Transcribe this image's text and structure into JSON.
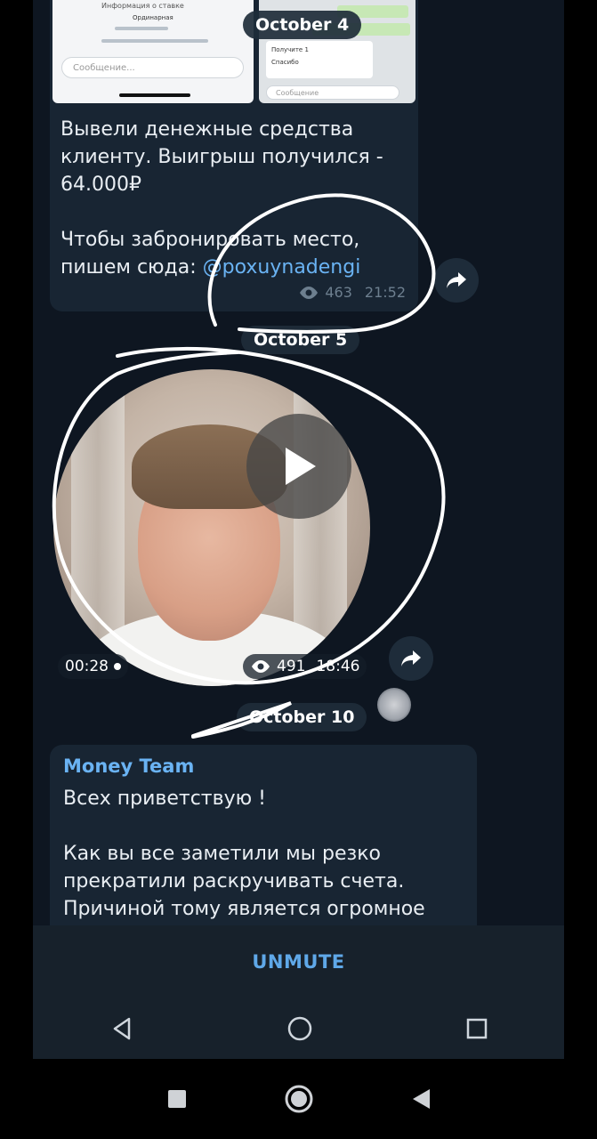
{
  "thumbnails": {
    "left_header": "Информация о ставке",
    "left_card": "Ординарная",
    "left_input_placeholder": "Сообщение...",
    "right_text_1": "Получите 1",
    "right_text_2": "Спасибо",
    "right_input_placeholder": "Сообщение"
  },
  "post1": {
    "line1": "Вывели денежные средства клиенту. Выигрыш получился - 64.000₽",
    "line2_prefix": "Чтобы забронировать место, пишем сюда: ",
    "link": "@poxuynadengi",
    "views": "463",
    "time": "21:52"
  },
  "dates": {
    "d1": "October 4",
    "d2": "October 5",
    "d3": "October 10"
  },
  "video": {
    "duration": "00:28",
    "views": "491",
    "time": "18:46"
  },
  "post2": {
    "sender": "Money Team",
    "line1": "Всех приветствую !",
    "line2": "Как вы все заметили мы резко прекратили раскручивать счета. Причиной тому является огромное"
  },
  "bottom": {
    "unmute": "UNMUTE"
  },
  "colors": {
    "chat_bg": "#0e1621",
    "bubble": "#182533",
    "link": "#6ab3f3",
    "accent": "#5fa8e8"
  },
  "icons": [
    "eye-icon",
    "share-icon",
    "play-icon",
    "back-icon",
    "home-icon",
    "recents-icon"
  ]
}
